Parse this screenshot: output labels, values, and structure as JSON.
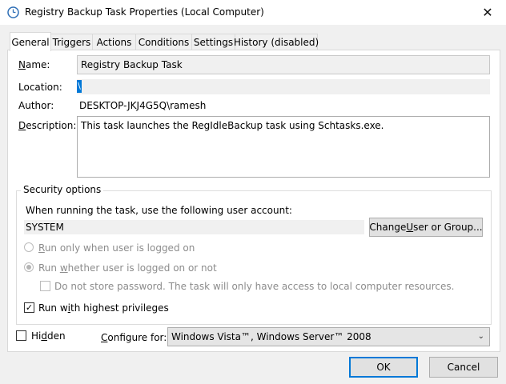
{
  "window": {
    "title": "Registry Backup Task Properties (Local Computer)",
    "close_glyph": "✕"
  },
  "tabs": [
    {
      "label": "General",
      "active": true
    },
    {
      "label": "Triggers",
      "active": false
    },
    {
      "label": "Actions",
      "active": false
    },
    {
      "label": "Conditions",
      "active": false
    },
    {
      "label": "Settings",
      "active": false
    },
    {
      "label": "History (disabled)",
      "active": false
    }
  ],
  "general": {
    "name_label": "Name:",
    "name_value": "Registry Backup Task",
    "location_label": "Location:",
    "location_value": "\\",
    "author_label": "Author:",
    "author_value": "DESKTOP-JKJ4G5Q\\ramesh",
    "description_label": "Description:",
    "description_value": "This task launches the RegIdleBackup task using Schtasks.exe."
  },
  "security": {
    "legend": "Security options",
    "account_prompt": "When running the task, use the following user account:",
    "account_value": "SYSTEM",
    "change_button": "Change User or Group...",
    "radio_logged_on": "Run only when user is logged on",
    "radio_whether": "Run whether user is logged on or not",
    "no_store_password": "Do not store password.  The task will only have access to local computer resources.",
    "highest_privileges": "Run with highest privileges"
  },
  "bottom": {
    "hidden_label": "Hidden",
    "configure_label": "Configure for:",
    "configure_value": "Windows Vista™, Windows Server™ 2008"
  },
  "buttons": {
    "ok": "OK",
    "cancel": "Cancel"
  },
  "colors": {
    "accent": "#0078d7",
    "selection": "#0078d7"
  }
}
